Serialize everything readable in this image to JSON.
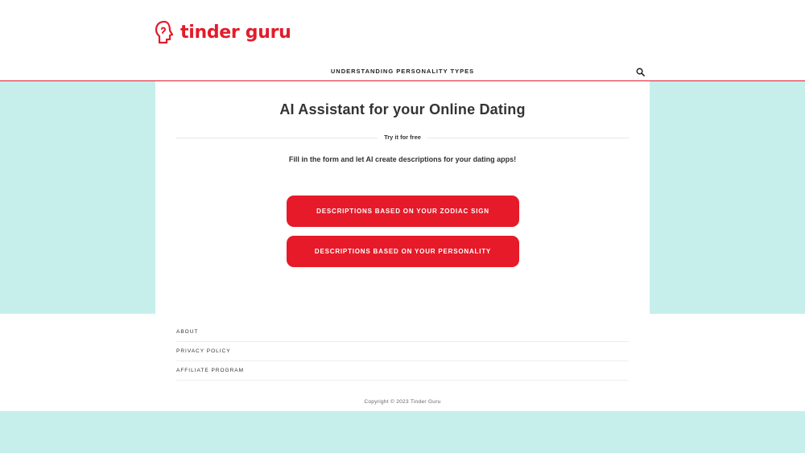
{
  "brand": {
    "name": "tinder guru",
    "color": "#e21c2b",
    "logo_icon": "head-profile-icon"
  },
  "nav": {
    "items": [
      {
        "label": "UNDERSTANDING PERSONALITY TYPES"
      }
    ],
    "search_icon": "search-icon"
  },
  "hero": {
    "title": "AI Assistant for your Online Dating",
    "divider_label": "Try it for free",
    "subtitle": "Fill in the form and let AI create descriptions for your dating apps!"
  },
  "actions": {
    "zodiac_label": "DESCRIPTIONS BASED ON YOUR ZODIAC SIGN",
    "personality_label": "DESCRIPTIONS BASED ON YOUR PERSONALITY",
    "button_color": "#e61a29"
  },
  "footer": {
    "links": [
      {
        "label": "ABOUT"
      },
      {
        "label": "PRIVACY POLICY"
      },
      {
        "label": "AFFILIATE PROGRAM"
      }
    ],
    "copyright": "Copyright © 2023 Tinder Guru"
  },
  "colors": {
    "accent": "#e21c2b",
    "band": "#c6efec"
  }
}
